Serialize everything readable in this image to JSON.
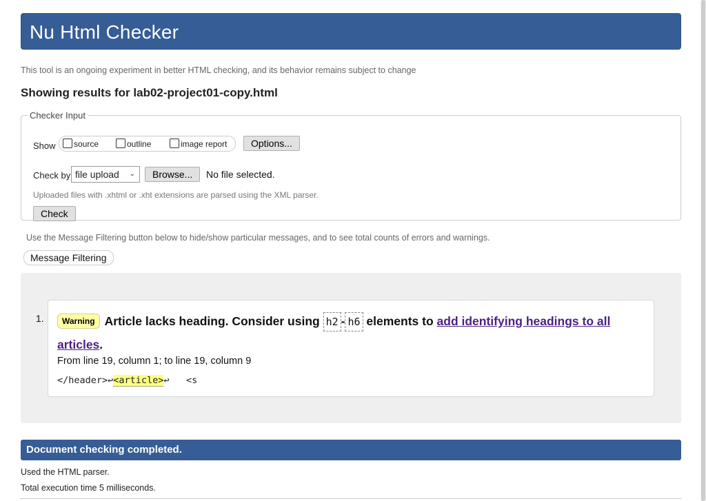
{
  "header": {
    "title": "Nu Html Checker"
  },
  "subtitle": "This tool is an ongoing experiment in better HTML checking, and its behavior remains subject to change",
  "results_title": "Showing results for lab02-project01-copy.html",
  "checker_input": {
    "legend": "Checker Input",
    "show_label": "Show",
    "show_options": [
      {
        "label": "source",
        "checked": false
      },
      {
        "label": "outline",
        "checked": false
      },
      {
        "label": "image report",
        "checked": false
      }
    ],
    "options_button": "Options...",
    "check_by_label": "Check by",
    "check_by_value": "file upload",
    "browse_button": "Browse...",
    "file_status": "No file selected.",
    "parser_note": "Uploaded files with .xhtml or .xht extensions are parsed using the XML parser.",
    "check_button": "Check"
  },
  "filter": {
    "note": "Use the Message Filtering button below to hide/show particular messages, and to see total counts of errors and warnings.",
    "button": "Message Filtering"
  },
  "messages": [
    {
      "number": "1.",
      "type": "Warning",
      "text_before": "Article lacks heading. Consider using ",
      "code1": "h2",
      "dash": "-",
      "code2": "h6",
      "text_mid": " elements to ",
      "link": "add identifying headings to all articles",
      "text_after": ".",
      "location": "From line 19, column 1; to line 19, column 9",
      "extract_before": "</header>",
      "extract_return1": "↩",
      "extract_highlight": "<article>",
      "extract_return2": "↩",
      "extract_after": "   <s"
    }
  ],
  "done": {
    "title": "Document checking completed.",
    "parser": "Used the HTML parser.",
    "time": "Total execution time 5 milliseconds."
  },
  "colors": {
    "brand_bar": "#365d95",
    "warning_badge": "#ffffa8",
    "link": "#4d1f82",
    "panel_bg": "#efefef"
  }
}
